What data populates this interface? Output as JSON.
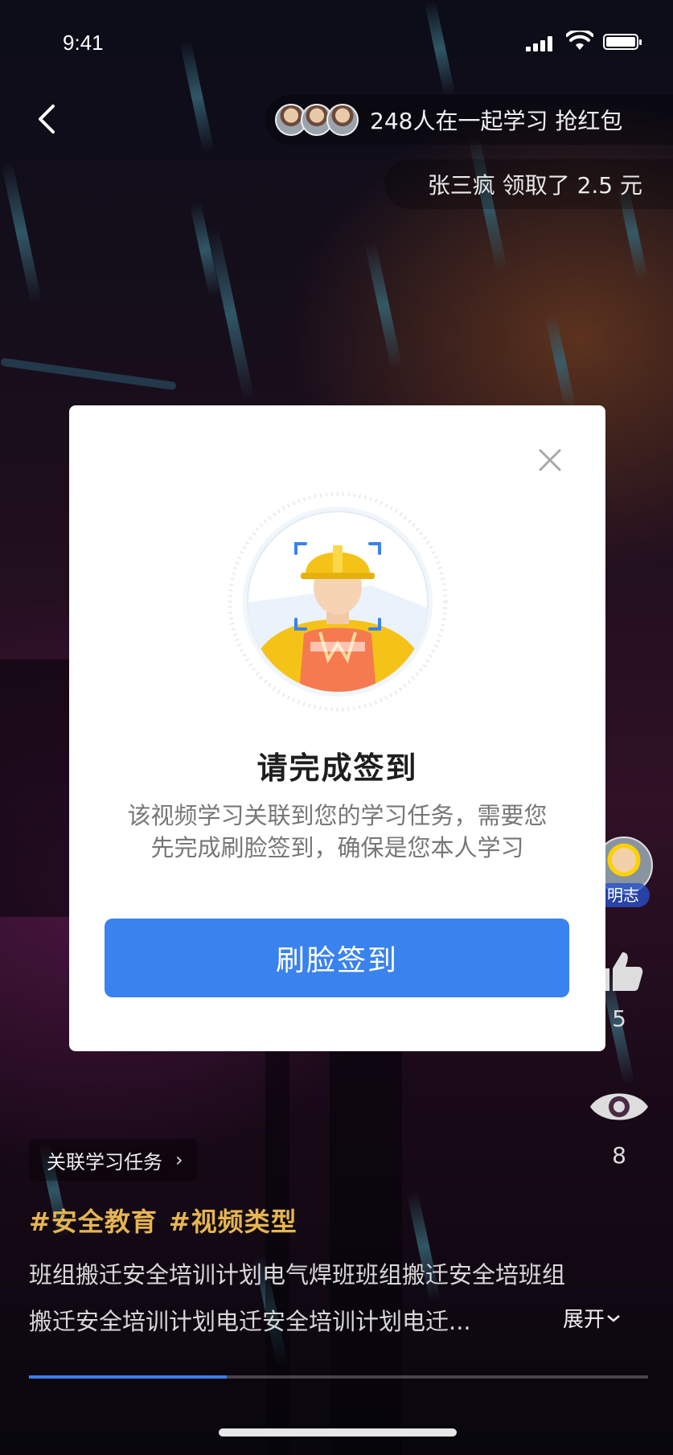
{
  "status_bar": {
    "time": "9:41"
  },
  "header": {
    "learners_text": "248人在一起学习 抢红包",
    "claim_text": "张三疯 领取了 2.5 元"
  },
  "right_rail": {
    "author_name": "明志",
    "like_count": "5",
    "view_count": "8"
  },
  "bottom": {
    "task_link": "关联学习任务",
    "tags": [
      "#安全教育",
      "#视频类型"
    ],
    "description_line1": "班组搬迁安全培训计划电气焊班班组搬迁安全培班组",
    "description_line2": "搬迁安全培训计划电迁安全培训计划电迁...",
    "expand_label": "展开",
    "progress": 0.32
  },
  "modal": {
    "title": "请完成签到",
    "description_line1": "该视频学习关联到您的学习任务，需要您",
    "description_line2": "先完成刷脸签到，确保是您本人学习",
    "button_label": "刷脸签到"
  },
  "colors": {
    "accent": "#3a82ee",
    "tag": "#e5b552",
    "helmet": "#f5c318",
    "vest": "#f57a50"
  }
}
